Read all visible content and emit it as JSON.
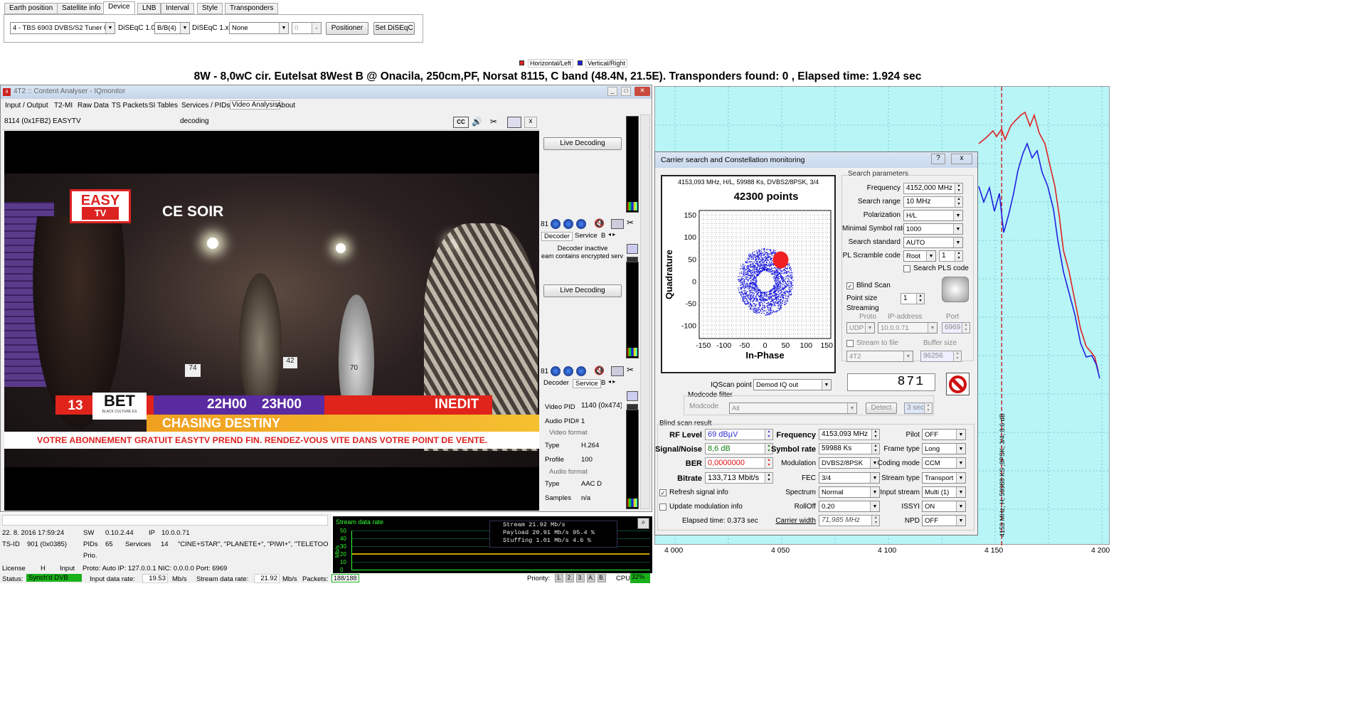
{
  "top_tabs": [
    "Earth position",
    "Satellite info",
    "Device",
    "LNB",
    "Interval",
    "Style",
    "Transponders"
  ],
  "device": {
    "tuner": "4 - TBS 6903 DVBS/S2 Tuner 0",
    "diseqc10_label": "DiSEqC 1.0:",
    "diseqc10_value": "B/B(4)",
    "diseqc1x_label": "DiSEqC 1.x:",
    "diseqc1x_value": "None",
    "spin_value": "0",
    "positioner": "Positioner",
    "set_diseqc": "Set DiSEqC"
  },
  "legend": {
    "h": "Horizontal/Left",
    "v": "Vertical/Right",
    "h_color": "#e02020",
    "v_color": "#2020e0"
  },
  "main_title": "8W - 8,0wC cir. Eutelsat 8West B @ Onacila, 250cm,PF, Norsat 8115, C band (48.4N, 21.5E). Transponders found: 0 , Elapsed time: 1.924 sec",
  "analyser": {
    "title": "4T2 :: Content Analyser - IQmonitor",
    "menu": [
      "Input / Output",
      "T2-MI",
      "Raw Data",
      "TS Packets",
      "SI Tables",
      "Services / PIDs",
      "Video Analysis",
      "About"
    ],
    "service": "8114 (0x1FB2) EASYTV",
    "status": "decoding",
    "close": "x",
    "video": {
      "logo1": "EASY",
      "logo2": "TV",
      "ce_soir": "CE SOIR",
      "num": "13",
      "bet": "BET",
      "culture": "BLACK CULTURE ES",
      "t1": "22H00",
      "t2": "23H00",
      "inedit": "INEDIT",
      "show": "CHASING DESTINY",
      "ticker": "VOTRE ABONNEMENT GRATUIT EASYTV PREND FIN. RENDEZ-VOUS VITE DANS VOTRE POINT DE VENTE."
    },
    "live1": "Live Decoding",
    "live2": "Live Decoding",
    "slot1": "81",
    "slot2": "81",
    "tabs_decoder": "Decoder",
    "tabs_service": "Service",
    "tabs_b": "B",
    "decoder_inactive": "Decoder inactive",
    "encrypted": "eam contains encrypted serv",
    "pid": {
      "video_pid_l": "Video PID",
      "video_pid": "1140 (0x474)",
      "audio_pid_l": "Audio PID#",
      "audio_pid": "1",
      "vformat": "Video format",
      "type_l": "Type",
      "vtype": "H.264",
      "profile_l": "Profile",
      "profile": "100",
      "aformat": "Audio format",
      "atype_l": "Type",
      "atype": "AAC D",
      "samples_l": "Samples",
      "samples": "n/a"
    },
    "info": {
      "date": "22. 8. 2016 17:59:24",
      "sw_l": "SW",
      "sw": "0.10.2.44",
      "ip_l": "IP",
      "ip": "10.0.0.71",
      "tsid_l": "TS-ID",
      "tsid": "901 (0x0385)",
      "pids_l": "PIDs",
      "pids": "65",
      "services_l": "Services",
      "services": "14",
      "channels": "\"CINE+STAR\", \"PLANETE+\", \"PIWI+\", \"TELETOON+\",",
      "prio": "Prio.",
      "license_l": "License",
      "license": "H",
      "input_l": "Input",
      "input": "Proto: Auto IP: 127.0.0.1 NIC: 0.0.0.0 Port: 6969",
      "status_l": "Status:",
      "status": "Synch'd DVB",
      "idr_l": "Input data rate:",
      "idr": "19.53",
      "mbs": "Mb/s",
      "sdr_l": "Stream data rate:",
      "sdr": "21.92",
      "mbs2": "Mb/s",
      "packets_l": "Packets:",
      "packets": "188/188",
      "priority_l": "Priority:",
      "prio_btns": [
        "1.",
        "2.",
        "3.",
        "A.",
        "B."
      ],
      "cpu_l": "CPU",
      "cpu": "32%"
    },
    "rate": {
      "title": "Stream data rate",
      "unit": "Mb/s",
      "ticks": [
        "50",
        "40",
        "30",
        "20",
        "10",
        "0"
      ],
      "stream": "Stream    21.92 Mb/s",
      "payload": "Payload   20.91 Mb/s   95.4 %",
      "stuffing": "Stuffing   1.01 Mb/s    4.6 %"
    }
  },
  "carrier": {
    "title": "Carrier search and Constellation monitoring",
    "help": "?",
    "close": "x",
    "header": "4153,093 MHz, H/L, 59988 Ks, DVBS2/8PSK, 3/4",
    "points": "42300 points",
    "xlabel": "In-Phase",
    "ylabel": "Quadrature",
    "xticks": [
      "-150",
      "-100",
      "-50",
      "0",
      "50",
      "100",
      "150"
    ],
    "yticks": [
      "150",
      "100",
      "50",
      "0",
      "-50",
      "-100"
    ],
    "sp": {
      "title": "Search parameters",
      "freq_l": "Frequency",
      "freq": "4152,000 MHz",
      "range_l": "Search range",
      "range": "10 MHz",
      "pol_l": "Polarization",
      "pol": "H/L",
      "msr_l": "Minimal Symbol rate",
      "msr": "1000",
      "std_l": "Search standard",
      "std": "AUTO",
      "pls_l": "PL Scramble code",
      "pls": "Root",
      "pls_n": "1",
      "search_pls": "Search PLS code",
      "blind": "Blind Scan",
      "ptsize_l": "Point size",
      "ptsize": "1",
      "streaming": "Streaming",
      "proto_l": "Proto",
      "ipaddr_l": "IP-address",
      "port_l": "Port",
      "proto": "UDP",
      "ipaddr": "10.0.0.71",
      "port": "6969",
      "stream_file": "Stream to file",
      "buffer_l": "Buffer size",
      "fileproto": "4T2",
      "buffer": "96256"
    },
    "lcd": "871",
    "iq_l": "IQScan point",
    "iq": "Demod IQ out",
    "modcode_filter": "Modcode filter",
    "modcode_l": "Modcode",
    "modcode": "All",
    "detect": "Detect",
    "sec": "3 sec",
    "bsr": "Blind scan result",
    "rf_l": "RF Level",
    "rf": "69 dBµV",
    "sn_l": "Signal/Noise",
    "sn": "8,6 dB",
    "ber_l": "BER",
    "ber": "0,0000000",
    "br_l": "Bitrate",
    "br": "133,713 Mbit/s",
    "frq_l": "Frequency",
    "frq": "4153,093 MHz",
    "sr_l": "Symbol rate",
    "sr": "59988 Ks",
    "mod_l": "Modulation",
    "mod": "DVBS2/8PSK",
    "fec_l": "FEC",
    "fec": "3/4",
    "spec_l": "Spectrum",
    "spec": "Normal",
    "roll_l": "RollOff",
    "roll": "0.20",
    "cw_l": "Carrier width",
    "cw": "71,985 MHz",
    "pilot_l": "Pilot",
    "pilot": "OFF",
    "ft_l": "Frame type",
    "ft": "Long",
    "cm_l": "Coding mode",
    "cm": "CCM",
    "st_l": "Stream type",
    "st": "Transport",
    "is_l": "Input stream",
    "is": "Multi (1)",
    "issyi_l": "ISSYI",
    "issyi": "ON",
    "npd_l": "NPD",
    "npd": "OFF",
    "refresh": "Refresh signal info",
    "update": "Update modulation info",
    "elapsed": "Elapsed time: 0.373 sec"
  },
  "spectrum": {
    "xticks": [
      "4 000",
      "4 050",
      "4 100",
      "4 150",
      "4 200"
    ],
    "marker": "4153 MHz; H; 59988 KS ;8PSK; 3/4; 8.6 dB"
  }
}
